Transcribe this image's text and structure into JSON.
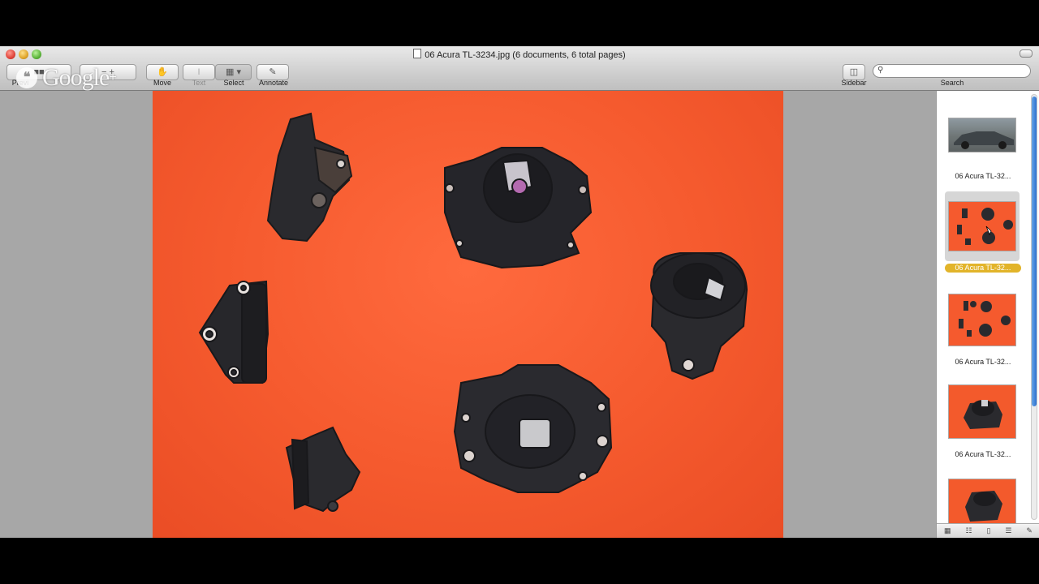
{
  "window": {
    "title": "06 Acura TL-3234.jpg (6 documents, 6 total pages)"
  },
  "toolbar": {
    "preview_label": "Previ",
    "move_label": "Move",
    "text_label": "Text",
    "select_label": "Select",
    "annotate_label": "Annotate",
    "sidebar_label": "Sidebar",
    "search_label": "Search",
    "search_value": ""
  },
  "overlay": {
    "logo_text": "Google",
    "logo_plus": "+"
  },
  "sidebar": {
    "thumbnails": [
      {
        "label": "06 Acura TL-32...",
        "selected": false
      },
      {
        "label": "06 Acura TL-32...",
        "selected": true
      },
      {
        "label": "06 Acura TL-32...",
        "selected": false
      },
      {
        "label": "06 Acura TL-32...",
        "selected": false
      },
      {
        "label": "",
        "selected": false
      }
    ]
  },
  "colors": {
    "photo_background": "#f55a2e",
    "selection": "#e2b42a",
    "scroll_thumb": "#2c6fcf"
  }
}
